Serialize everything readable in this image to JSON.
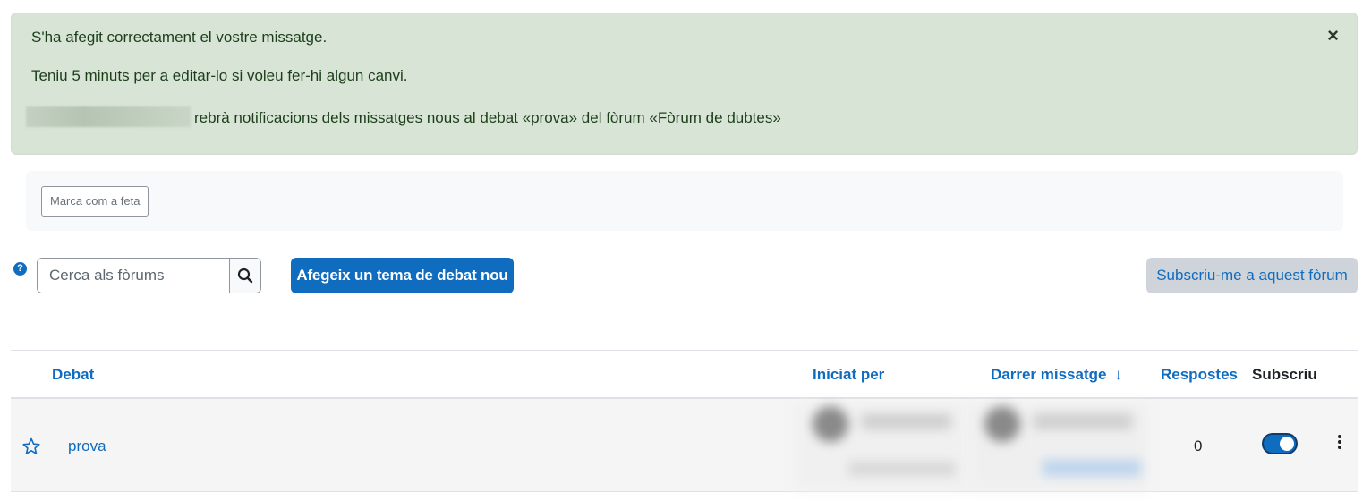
{
  "alert": {
    "line1": "S'ha afegit correctament el vostre missatge.",
    "line2": "Teniu 5 minuts per a editar-lo si voleu fer-hi algun canvi.",
    "line3": "rebrà notificacions dels missatges nous al debat «prova» del fòrum «Fòrum de dubtes»",
    "close_label": "×"
  },
  "completion": {
    "mark_done_label": "Marca com a feta"
  },
  "toolbar": {
    "search_placeholder": "Cerca als fòrums",
    "add_topic_label": "Afegeix un tema de debat nou",
    "subscribe_label": "Subscriu-me a aquest fòrum"
  },
  "table": {
    "headers": {
      "discussion": "Debat",
      "started_by": "Iniciat per",
      "last_post": "Darrer missatge",
      "sort_arrow": "↓",
      "replies": "Respostes",
      "subscribe": "Subscriu"
    },
    "rows": [
      {
        "topic": "prova",
        "replies": "0",
        "subscribed": true,
        "starred": false
      }
    ]
  },
  "colors": {
    "accent": "#0f6cbf",
    "alert_bg": "#d7e4d6",
    "alert_text": "#1c3f1a",
    "secondary_btn_bg": "#ced4da"
  }
}
